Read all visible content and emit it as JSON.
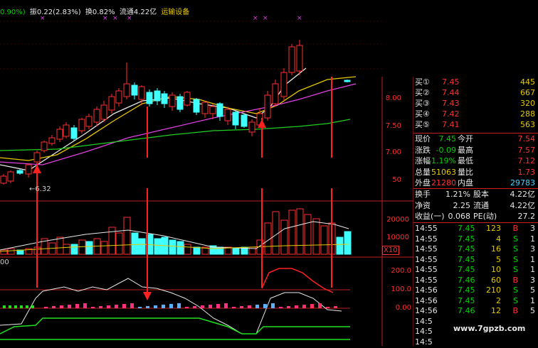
{
  "header": {
    "pct": "0.90%)",
    "amplitude": "振0.22(2.83%)",
    "turnover": "换0.82%",
    "float_cap": "流通4.22亿",
    "sector": "运输设备"
  },
  "main_chart": {
    "price_ticks": [
      "8.00",
      "7.50",
      "7.00"
    ],
    "small_tick": "50",
    "low_marker": "6.32"
  },
  "volume_chart": {
    "ticks": [
      "20000",
      "10000"
    ],
    "unit": "X10",
    "left_label": "00"
  },
  "indicator_chart": {
    "ticks": [
      "200.0",
      "100.0",
      "0.00"
    ]
  },
  "order_book": [
    {
      "label": "买①",
      "price": "7.45",
      "vol": "445"
    },
    {
      "label": "买②",
      "price": "7.44",
      "vol": "667"
    },
    {
      "label": "买③",
      "price": "7.43",
      "vol": "320"
    },
    {
      "label": "买④",
      "price": "7.42",
      "vol": "288"
    },
    {
      "label": "买⑤",
      "price": "7.41",
      "vol": "563"
    }
  ],
  "quote": {
    "current_label": "现价",
    "current": "7.45",
    "open_label": "今开",
    "open": "7.54",
    "change_label": "涨跌",
    "change": "-0.09",
    "high_label": "最高",
    "high": "7.57",
    "pct_label": "涨幅",
    "pct": "-1.19%",
    "low_label": "最低",
    "low": "7.12",
    "vol_label": "总量",
    "vol": "51063",
    "ratio_label": "量比",
    "ratio": "1.73",
    "outer_label": "外盘",
    "outer": "21280",
    "inner_label": "内盘",
    "inner": "29783"
  },
  "stats": {
    "turnover_label": "换手",
    "turnover": "1.21%",
    "equity_label": "股本",
    "equity": "4.22亿",
    "nav_label": "净资",
    "nav": "2.25",
    "float_label": "流通",
    "float": "4.22亿",
    "eps_label": "收益(一)",
    "eps": "0.068",
    "pe_label": "PE(动)",
    "pe": "27.2"
  },
  "ticks": [
    {
      "time": "14:55",
      "price": "7.45",
      "vol": "123",
      "side": "B",
      "n": "3"
    },
    {
      "time": "14:55",
      "price": "7.45",
      "vol": "4",
      "side": "S",
      "n": "1"
    },
    {
      "time": "14:55",
      "price": "7.45",
      "vol": "16",
      "side": "S",
      "n": "3"
    },
    {
      "time": "14:55",
      "price": "7.45",
      "vol": "5",
      "side": "S",
      "n": "1"
    },
    {
      "time": "14:55",
      "price": "7.45",
      "vol": "10",
      "side": "S",
      "n": "1"
    },
    {
      "time": "14:55",
      "price": "7.46",
      "vol": "60",
      "side": "B",
      "n": "3"
    },
    {
      "time": "14:56",
      "price": "7.45",
      "vol": "210",
      "side": "S",
      "n": "5"
    },
    {
      "time": "14:56",
      "price": "7.45",
      "vol": "2",
      "side": "S",
      "n": "1"
    },
    {
      "time": "14:56",
      "price": "7.46",
      "vol": "12",
      "side": "B",
      "n": "5"
    },
    {
      "time": "14:5",
      "price": "",
      "vol": "",
      "side": "",
      "n": ""
    },
    {
      "time": "14:5",
      "price": "",
      "vol": "",
      "side": "",
      "n": ""
    },
    {
      "time": "14:5",
      "price": "",
      "vol": "",
      "side": "",
      "n": ""
    }
  ],
  "watermark": "www.7gpzb.com",
  "colors": {
    "up": "#ff3030",
    "down": "#40ffff",
    "ma_white": "#e8e8e8",
    "ma_yellow": "#e6c800",
    "ma_magenta": "#e040e0",
    "ma_green": "#20d020"
  }
}
